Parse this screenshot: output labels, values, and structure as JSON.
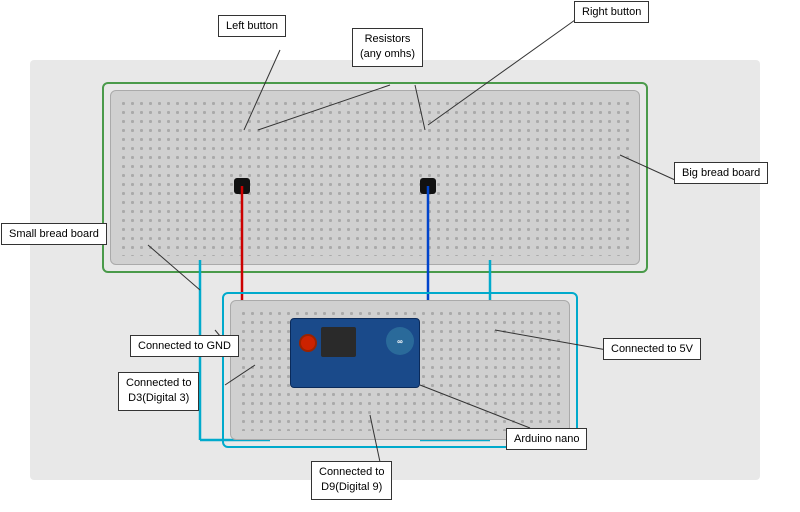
{
  "labels": {
    "left_button": "Left button",
    "right_button": "Right button",
    "resistors": "Resistors\n(any omhs)",
    "small_breadboard": "Small bread board",
    "big_breadboard": "Big bread board",
    "connected_gnd": "Connected to GND",
    "connected_d3": "Connected to\nD3(Digital 3)",
    "connected_5v": "Connected to 5V",
    "connected_d9": "Connected to\nD9(Digital 9)",
    "arduino_nano": "Arduino nano"
  },
  "colors": {
    "green_border": "#4a9a4a",
    "cyan_border": "#00aacc",
    "red_wire": "#cc0000",
    "blue_wire": "#0044cc",
    "cyan_wire": "#00aacc",
    "background": "#e8e8e8"
  }
}
